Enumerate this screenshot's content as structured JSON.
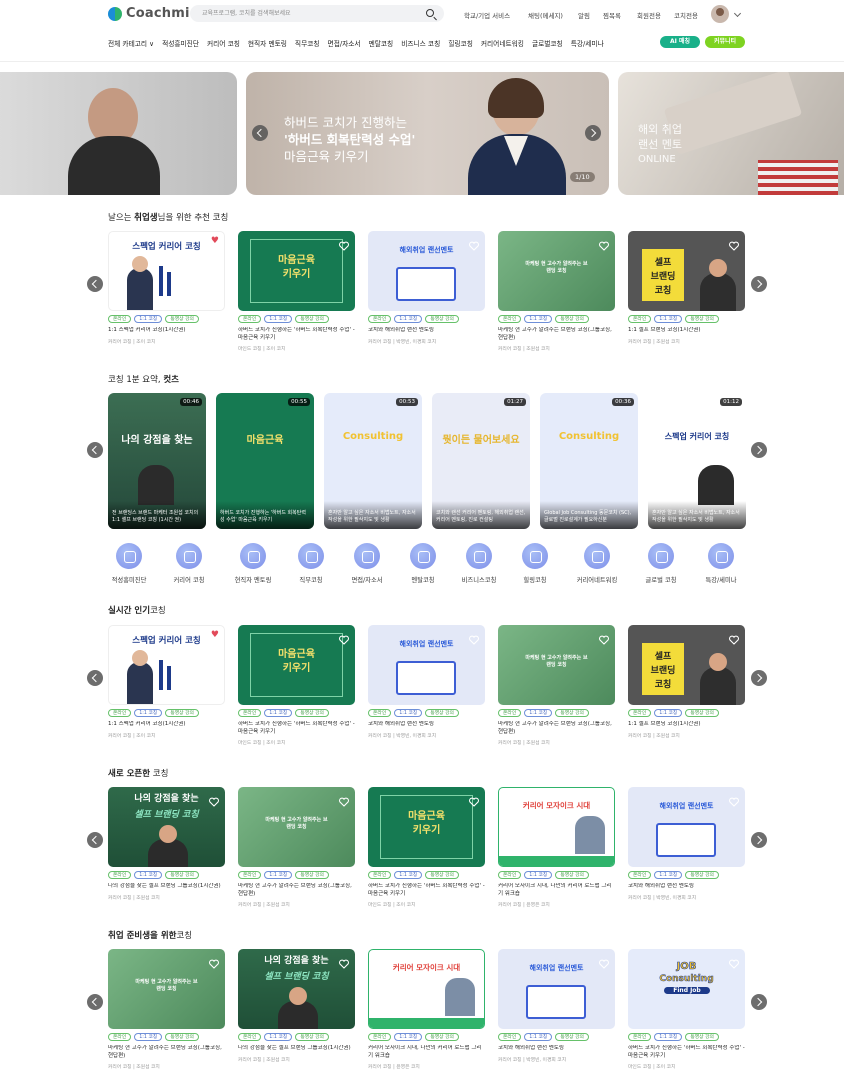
{
  "header": {
    "logo": "Coachmi",
    "search_placeholder": "교육프로그램, 코치를 검색해보세요",
    "links": [
      "학교/기업 서비스",
      "채팅(메세지)",
      "알림",
      "찜목록",
      "회원전용",
      "코치전용"
    ],
    "nav": [
      "전체 카테고리 ∨",
      "적성흥미진단",
      "커리어 코칭",
      "현직자 멘토링",
      "직무코칭",
      "면접/자소서",
      "멘탈코칭",
      "비즈니스 코칭",
      "힐링코칭",
      "커리어네트워킹",
      "글로벌코칭",
      "특강/세미나"
    ],
    "ai_button": "AI 매칭",
    "community_button": "커뮤니티"
  },
  "banner": {
    "main_line1": "하버드 코치가 진행하는",
    "main_line2": "'하버드 회복탄력성 수업'",
    "main_line3": "마음근육 키우기",
    "counter": "1/10",
    "right_line1": "해외 취업",
    "right_line2": "랜선 멘토",
    "right_line3": "ONLINE"
  },
  "sections": {
    "s1": {
      "pre": "날으는 ",
      "bold": "취업생",
      "post": "님을 위한 추천 코칭"
    },
    "s2": {
      "pre": "코칭 1분 요약, ",
      "bold": "컷츠",
      "post": ""
    },
    "s3": {
      "pre": "",
      "bold": "실시간 인기",
      "post": "코칭"
    },
    "s4": {
      "pre": "",
      "bold": "새로 오픈한",
      "post": " 코칭"
    },
    "s5": {
      "pre": "",
      "bold": "취업 준비생을 위한",
      "post": "코칭"
    }
  },
  "tags": {
    "online": "온라인",
    "one_on_one": "1:1 코칭",
    "video": "동영상 강의"
  },
  "thumb_text": {
    "spec": "스펙업 커리어 코칭",
    "mind1": "마음근육",
    "mind2": "키우기",
    "lan": "해외취업 랜선멘토",
    "self1": "셀프",
    "self2": "브랜딩",
    "self3": "코칭",
    "marketing": "마케팅 현 고수가 알려주는 브랜딩 코칭",
    "strength1": "나의 강점을 찾는",
    "strength2": "셀프 브랜딩 코칭",
    "mosaic": "커리어 모자이크 시대",
    "job1": "JOB",
    "job2": "Consulting",
    "job3": "Find Job",
    "ask": "뭣이든 물어보세요"
  },
  "rows": {
    "r1": [
      {
        "title": "1:1 스펙업 커리어 코칭(1시간권)",
        "meta": "커리어 코칭 | 조이 코치"
      },
      {
        "title": "하버드 코치가 진행하는 '하버드 회복탄력성 수업' - 마음근육 키우기",
        "meta": "마인드 코칭 | 조이 코치"
      },
      {
        "title": "코치와 해외취업 랜선 멘토링",
        "meta": "커리어 코칭 | 박영빈, 이경희 코치"
      },
      {
        "title": "마케팅 현 고수가 알려주는 브랜딩 코칭(그룹코칭, 현답편)",
        "meta": "커리어 코칭 | 조원섭 코치"
      },
      {
        "title": "1:1 셀프 브랜딩 코칭(1시간권)",
        "meta": "커리어 코칭 | 조원섭 코치"
      }
    ],
    "r3": [
      {
        "title": "1:1 스펙업 커리어 코칭(1시간권)",
        "meta": "커리어 코칭 | 조이 코치"
      },
      {
        "title": "하버드 코치가 진행하는 '하버드 회복탄력성 수업' - 마음근육 키우기",
        "meta": "마인드 코칭 | 조이 코치"
      },
      {
        "title": "코치와 해외취업 랜선 멘토링",
        "meta": "커리어 코칭 | 박영빈, 이경희 코치"
      },
      {
        "title": "마케팅 현 고수가 알려주는 브랜딩 코칭(그룹코칭, 현답편)",
        "meta": "커리어 코칭 | 조원섭 코치"
      },
      {
        "title": "1:1 셀프 브랜딩 코칭(1시간권)",
        "meta": "커리어 코칭 | 조원섭 코치"
      }
    ],
    "r4": [
      {
        "title": "나의 강점을 찾는 셀프 브랜딩 그룹코칭(1시간권)",
        "meta": "커리어 코칭 | 조원섭 코치"
      },
      {
        "title": "마케팅 현 고수가 알려주는 브랜딩 코칭(그룹코칭, 현답편)",
        "meta": "커리어 코칭 | 조원섭 코치"
      },
      {
        "title": "하버드 코치가 진행하는 '하버드 회복탄력성 수업' - 마음근육 키우기",
        "meta": "마인드 코칭 | 조이 코치"
      },
      {
        "title": "커리어 모자이크 시대, 나만의 커리어 로드맵 그리기 워크숍",
        "meta": "커리어 코칭 | 윤영은 코치"
      },
      {
        "title": "코치와 해외취업 랜선 멘토링",
        "meta": "커리어 코칭 | 박영빈, 이경희 코치"
      }
    ],
    "r5": [
      {
        "title": "마케팅 현 고수가 알려주는 브랜딩 코칭(그룹코칭, 현답편)",
        "meta": "커리어 코칭 | 조원섭 코치"
      },
      {
        "title": "나의 강점을 찾는 셀프 브랜딩 그룹코칭(1시간권)",
        "meta": "커리어 코칭 | 조원섭 코치"
      },
      {
        "title": "커리어 모자이크 시대, 나만의 커리어 로드맵 그리기 워크숍",
        "meta": "커리어 코칭 | 윤영은 코치"
      },
      {
        "title": "코치와 해외취업 랜선 멘토링",
        "meta": "커리어 코칭 | 박영빈, 이경희 코치"
      },
      {
        "title": "하버드 코치가 진행하는 '하버드 회복탄력성 수업' - 마음근육 키우기",
        "meta": "마인드 코칭 | 조이 코치"
      }
    ]
  },
  "shorts": [
    {
      "duration": "00:46",
      "caption": "전 브랜딩스 브랜드 마케터 조원섭 코치의 1:1 셀프 브랜딩 코칭 (1시간 권)"
    },
    {
      "duration": "00:55",
      "caption": "하버드 코치가 진행하는 '하버드 회복탄력성 수업' 마음근육 키우기"
    },
    {
      "duration": "00:53",
      "caption": "혼자만 알고 싶은 자소서 비법노트, 자소서 작성을 위한 필삭지도 및 생활"
    },
    {
      "duration": "01:27",
      "caption": "코치와 랜선 커리어 멘토링, 해외취업 랜선, 커리어 멘토링, 진로 컨설팅"
    },
    {
      "duration": "00:36",
      "caption": "Global Job Consulting 동문코치 (SC), 글로벌 진로설계가 필요하신분"
    },
    {
      "duration": "01:12",
      "caption": "혼자만 알고 싶은 자소서 비법노트, 자소서 작성을 위한 필삭지도 및 생활"
    }
  ],
  "categories": [
    "적성흥미진단",
    "커리어 코칭",
    "현직자 멘토링",
    "직무코칭",
    "면접/자소서",
    "멘탈코칭",
    "비즈니스코칭",
    "힐링코칭",
    "커리어네트워킹",
    "글로벌 코칭",
    "특강/세미나"
  ],
  "colors": {
    "brand_green": "#2fb36b",
    "ai_button": "#19b089",
    "community_button": "#7ed321",
    "tag_green": "#3d9b42",
    "tag_blue": "#4a6bc2"
  }
}
